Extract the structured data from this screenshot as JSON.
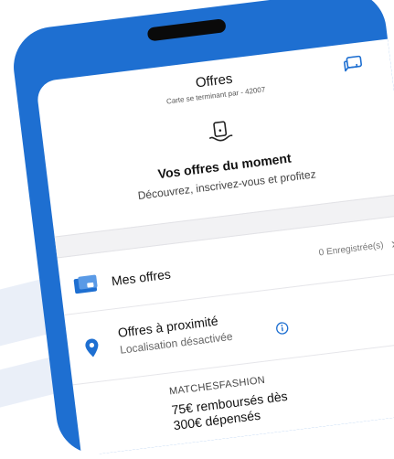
{
  "header": {
    "title": "Offres",
    "subtitle": "Carte se terminant par - 42007"
  },
  "hero": {
    "title": "Vos offres du moment",
    "subtitle": "Découvrez, inscrivez-vous et profitez"
  },
  "rows": {
    "mes_offres": {
      "label": "Mes offres",
      "count": "0 Enregistrée(s)"
    },
    "proximite": {
      "label": "Offres à proximité",
      "status": "Localisation désactivée"
    },
    "offer": {
      "brand": "MATCHESFASHION",
      "line1": "75€ remboursés dès",
      "line2": "300€ dépensés"
    }
  },
  "icons": {
    "chat": "chat-bubbles-icon",
    "gift": "tag-hand-icon",
    "wallet": "wallet-card-icon",
    "location": "location-pin-icon",
    "info": "info-icon",
    "chevron": "chevron-right-icon"
  },
  "colors": {
    "frame": "#1e6fd1",
    "accent": "#1e6fd1",
    "background_stripe": "#eaeff8"
  }
}
